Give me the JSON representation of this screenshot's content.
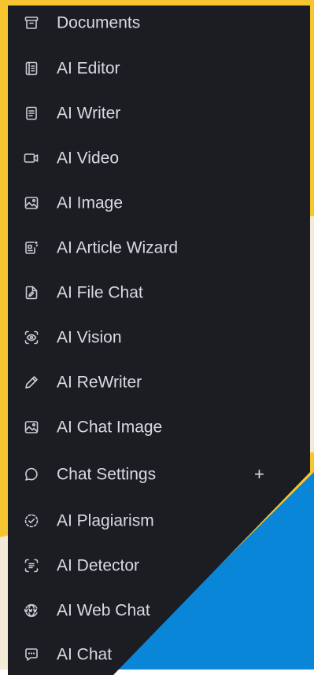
{
  "menu": {
    "items": [
      {
        "label": "Documents",
        "icon": "archive-icon"
      },
      {
        "label": "AI Editor",
        "icon": "notebook-icon"
      },
      {
        "label": "AI Writer",
        "icon": "document-text-icon"
      },
      {
        "label": "AI Video",
        "icon": "video-camera-icon"
      },
      {
        "label": "AI Image",
        "icon": "image-icon"
      },
      {
        "label": "AI Article Wizard",
        "icon": "article-wizard-icon"
      },
      {
        "label": "AI File Chat",
        "icon": "file-edit-icon"
      },
      {
        "label": "AI Vision",
        "icon": "vision-eye-icon"
      },
      {
        "label": "AI ReWriter",
        "icon": "pencil-icon"
      },
      {
        "label": "AI Chat Image",
        "icon": "image-icon"
      },
      {
        "label": "Chat Settings",
        "icon": "chat-bubble-icon",
        "expand": "+"
      },
      {
        "label": "AI Plagiarism",
        "icon": "check-circle-dashed-icon"
      },
      {
        "label": "AI Detector",
        "icon": "scan-text-icon"
      },
      {
        "label": "AI Web Chat",
        "icon": "globe-www-icon"
      },
      {
        "label": "AI Chat",
        "icon": "message-icon"
      }
    ]
  },
  "colors": {
    "panel": "#1b1d23",
    "text": "#d8dbe2",
    "accent_yellow": "#f6c530",
    "accent_blue": "#0a86d8",
    "cream": "#f3ead7"
  }
}
